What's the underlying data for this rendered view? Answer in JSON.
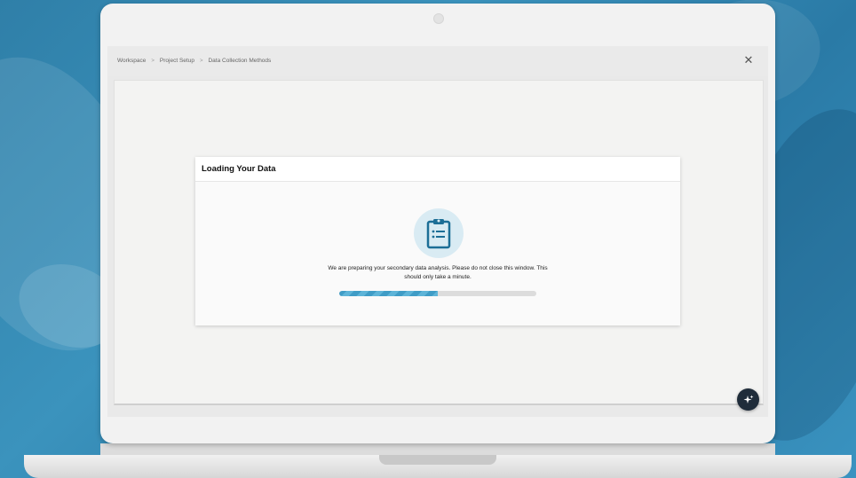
{
  "breadcrumb": {
    "items": [
      "Workspace",
      "Project Setup",
      "Data Collection Methods"
    ],
    "separator": ">"
  },
  "close_button": {
    "label": "✕"
  },
  "modal": {
    "title": "Loading Your Data",
    "icon": "clipboard-list-icon",
    "message": "We are preparing your secondary data analysis. Please do not close this window. This should only take a minute.",
    "progress_fraction": 0.5
  },
  "fab": {
    "icon": "sparkle-icon"
  },
  "colors": {
    "accent": "#3f9cc6",
    "icon_dark": "#1c6e96",
    "icon_circle": "#d9ebf3",
    "fab": "#1f2c3a"
  }
}
